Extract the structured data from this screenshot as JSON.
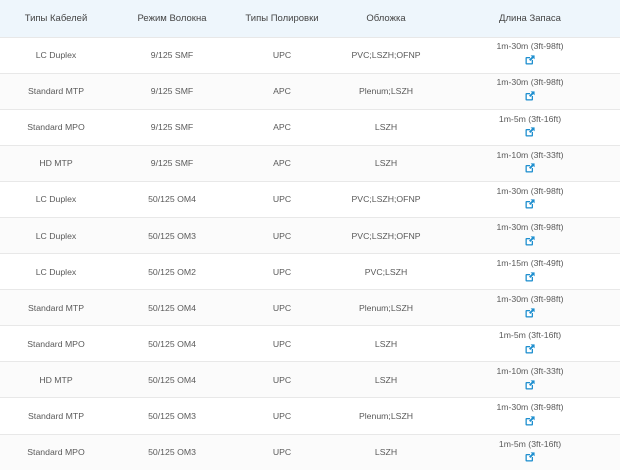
{
  "table": {
    "headers": [
      "Типы Кабелей",
      "Режим Волокна",
      "Типы Полировки",
      "Обложка",
      "Длина Запаса"
    ],
    "link_icon": "external-link-icon",
    "accent_color": "#1f8fcf",
    "header_bg": "#eef6fc",
    "rows": [
      {
        "cable": "LC Duplex",
        "mode": "9/125 SMF",
        "polish": "UPC",
        "jacket": "PVC;LSZH;OFNP",
        "length": "1m-30m (3ft-98ft)"
      },
      {
        "cable": "Standard MTP",
        "mode": "9/125 SMF",
        "polish": "APC",
        "jacket": "Plenum;LSZH",
        "length": "1m-30m (3ft-98ft)"
      },
      {
        "cable": "Standard MPO",
        "mode": "9/125 SMF",
        "polish": "APC",
        "jacket": "LSZH",
        "length": "1m-5m (3ft-16ft)"
      },
      {
        "cable": "HD MTP",
        "mode": "9/125 SMF",
        "polish": "APC",
        "jacket": "LSZH",
        "length": "1m-10m (3ft-33ft)"
      },
      {
        "cable": "LC Duplex",
        "mode": "50/125 OM4",
        "polish": "UPC",
        "jacket": "PVC;LSZH;OFNP",
        "length": "1m-30m (3ft-98ft)"
      },
      {
        "cable": "LC Duplex",
        "mode": "50/125 OM3",
        "polish": "UPC",
        "jacket": "PVC;LSZH;OFNP",
        "length": "1m-30m (3ft-98ft)"
      },
      {
        "cable": "LC Duplex",
        "mode": "50/125 OM2",
        "polish": "UPC",
        "jacket": "PVC;LSZH",
        "length": "1m-15m (3ft-49ft)"
      },
      {
        "cable": "Standard MTP",
        "mode": "50/125 OM4",
        "polish": "UPC",
        "jacket": "Plenum;LSZH",
        "length": "1m-30m (3ft-98ft)"
      },
      {
        "cable": "Standard MPO",
        "mode": "50/125 OM4",
        "polish": "UPC",
        "jacket": "LSZH",
        "length": "1m-5m (3ft-16ft)"
      },
      {
        "cable": "HD MTP",
        "mode": "50/125 OM4",
        "polish": "UPC",
        "jacket": "LSZH",
        "length": "1m-10m (3ft-33ft)"
      },
      {
        "cable": "Standard MTP",
        "mode": "50/125 OM3",
        "polish": "UPC",
        "jacket": "Plenum;LSZH",
        "length": "1m-30m (3ft-98ft)"
      },
      {
        "cable": "Standard MPO",
        "mode": "50/125 OM3",
        "polish": "UPC",
        "jacket": "LSZH",
        "length": "1m-5m (3ft-16ft)"
      }
    ]
  }
}
